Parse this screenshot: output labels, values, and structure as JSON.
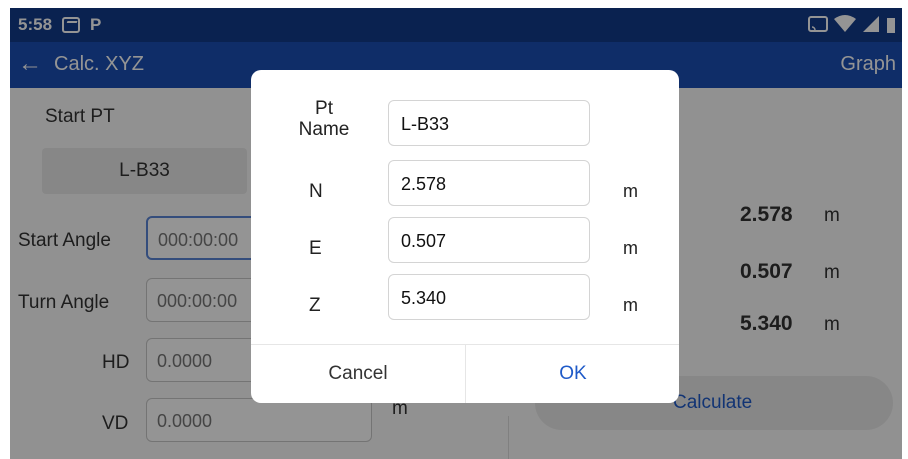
{
  "status_bar": {
    "time": "5:58",
    "p_icon": "P"
  },
  "toolbar": {
    "back_icon": "←",
    "title": "Calc. XYZ",
    "graph": "Graph"
  },
  "form": {
    "start_pt_label": "Start PT",
    "start_pt_value": "L-B33",
    "start_angle_label": "Start Angle",
    "start_angle_value": "000:00:00",
    "turn_angle_label": "Turn Angle",
    "turn_angle_value": "000:00:00",
    "hd_label": "HD",
    "hd_value": "0.0000",
    "vd_label": "VD",
    "vd_value": "0.0000",
    "vd_unit": "m"
  },
  "results": [
    {
      "value": "2.578",
      "unit": "m"
    },
    {
      "value": "0.507",
      "unit": "m"
    },
    {
      "value": "5.340",
      "unit": "m"
    }
  ],
  "calculate_label": "Calculate",
  "dialog": {
    "pt_name_label_line1": "Pt",
    "pt_name_label_line2": "Name",
    "pt_name_value": "L-B33",
    "rows": [
      {
        "label": "N",
        "value": "2.578",
        "unit": "m"
      },
      {
        "label": "E",
        "value": "0.507",
        "unit": "m"
      },
      {
        "label": "Z",
        "value": "5.340",
        "unit": "m"
      }
    ],
    "cancel": "Cancel",
    "ok": "OK"
  },
  "colors": {
    "status_bar": "#123b8a",
    "toolbar": "#1b4fb3",
    "accent": "#1f5ac8"
  }
}
